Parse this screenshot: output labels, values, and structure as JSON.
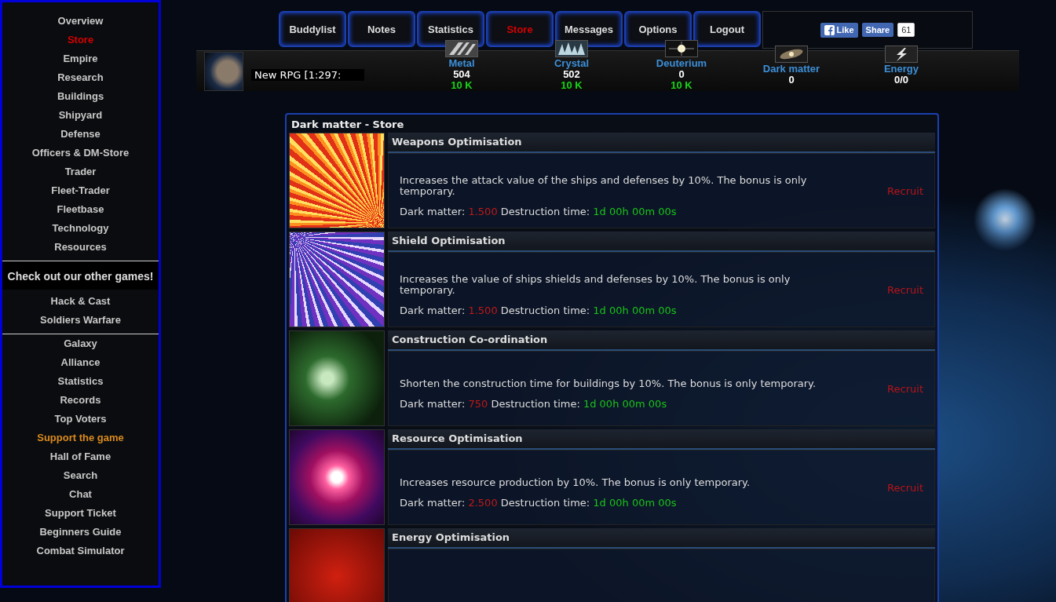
{
  "sidebar": {
    "sections": [
      {
        "items": [
          {
            "label": "Overview",
            "selected": false,
            "kind": "normal"
          },
          {
            "label": "Store",
            "selected": true,
            "kind": "normal"
          },
          {
            "label": "Empire",
            "selected": false,
            "kind": "normal"
          },
          {
            "label": "Research",
            "selected": false,
            "kind": "normal"
          },
          {
            "label": "Buildings",
            "selected": false,
            "kind": "normal"
          },
          {
            "label": "Shipyard",
            "selected": false,
            "kind": "normal"
          },
          {
            "label": "Defense",
            "selected": false,
            "kind": "normal"
          },
          {
            "label": "Officers & DM-Store",
            "selected": false,
            "kind": "normal"
          },
          {
            "label": "Trader",
            "selected": false,
            "kind": "normal"
          },
          {
            "label": "Fleet-Trader",
            "selected": false,
            "kind": "normal"
          },
          {
            "label": "Fleetbase",
            "selected": false,
            "kind": "normal"
          },
          {
            "label": "Technology",
            "selected": false,
            "kind": "normal"
          },
          {
            "label": "Resources",
            "selected": false,
            "kind": "normal"
          }
        ]
      },
      {
        "heading": "Check out our other games!",
        "items": [
          {
            "label": "Hack & Cast",
            "selected": false,
            "kind": "normal"
          },
          {
            "label": "Soldiers Warfare",
            "selected": false,
            "kind": "normal"
          }
        ]
      },
      {
        "items": [
          {
            "label": "Galaxy",
            "selected": false,
            "kind": "normal"
          },
          {
            "label": "Alliance",
            "selected": false,
            "kind": "normal"
          },
          {
            "label": "Statistics",
            "selected": false,
            "kind": "normal"
          },
          {
            "label": "Records",
            "selected": false,
            "kind": "normal"
          },
          {
            "label": "Top Voters",
            "selected": false,
            "kind": "normal"
          },
          {
            "label": "Support the game",
            "selected": false,
            "kind": "promo"
          },
          {
            "label": "Hall of Fame",
            "selected": false,
            "kind": "normal"
          },
          {
            "label": "Search",
            "selected": false,
            "kind": "normal"
          },
          {
            "label": "Chat",
            "selected": false,
            "kind": "normal"
          },
          {
            "label": "Support Ticket",
            "selected": false,
            "kind": "normal"
          },
          {
            "label": "Beginners Guide",
            "selected": false,
            "kind": "normal"
          },
          {
            "label": "Combat Simulator",
            "selected": false,
            "kind": "normal"
          }
        ]
      }
    ]
  },
  "tabs": [
    {
      "label": "Buddylist",
      "selected": false
    },
    {
      "label": "Notes",
      "selected": false
    },
    {
      "label": "Statistics",
      "selected": false
    },
    {
      "label": "Store",
      "selected": true
    },
    {
      "label": "Messages",
      "selected": false
    },
    {
      "label": "Options",
      "selected": false
    },
    {
      "label": "Logout",
      "selected": false
    }
  ],
  "social": {
    "like": "Like",
    "share": "Share",
    "count": "61"
  },
  "planet": {
    "value": "New RPG [1:297:"
  },
  "resources": [
    {
      "kind": "metal",
      "name": "Metal",
      "amount": "504",
      "production": "10 K"
    },
    {
      "kind": "crystal",
      "name": "Crystal",
      "amount": "502",
      "production": "10 K"
    },
    {
      "kind": "deuterium",
      "name": "Deuterium",
      "amount": "0",
      "production": "10 K"
    },
    {
      "kind": "darkmatter",
      "name": "Dark matter",
      "amount": "0"
    },
    {
      "kind": "energy",
      "name": "Energy",
      "amount": "0/0"
    }
  ],
  "store": {
    "title": "Dark matter - Store",
    "items": [
      {
        "kind": "weapons",
        "title": "Weapons Optimisation",
        "description": "Increases the attack value of the ships and defenses by 10%. The bonus is only temporary.",
        "cost_label": "Dark matter:",
        "cost": "1.500",
        "duration_label": "Destruction time:",
        "duration": "1d 00h 00m 00s",
        "action": "Recruit"
      },
      {
        "kind": "shield",
        "title": "Shield Optimisation",
        "description": "Increases the value of ships shields and defenses by 10%. The bonus is only temporary.",
        "cost_label": "Dark matter:",
        "cost": "1.500",
        "duration_label": "Destruction time:",
        "duration": "1d 00h 00m 00s",
        "action": "Recruit"
      },
      {
        "kind": "construction",
        "title": "Construction Co-ordination",
        "description": "Shorten the construction time for buildings by 10%. The bonus is only temporary.",
        "cost_label": "Dark matter:",
        "cost": "750",
        "duration_label": "Destruction time:",
        "duration": "1d 00h 00m 00s",
        "action": "Recruit"
      },
      {
        "kind": "resource",
        "title": "Resource Optimisation",
        "description": "Increases resource production by 10%. The bonus is only temporary.",
        "cost_label": "Dark matter:",
        "cost": "2.500",
        "duration_label": "Destruction time:",
        "duration": "1d 00h 00m 00s",
        "action": "Recruit"
      },
      {
        "kind": "energy",
        "title": "Energy Optimisation"
      }
    ]
  }
}
